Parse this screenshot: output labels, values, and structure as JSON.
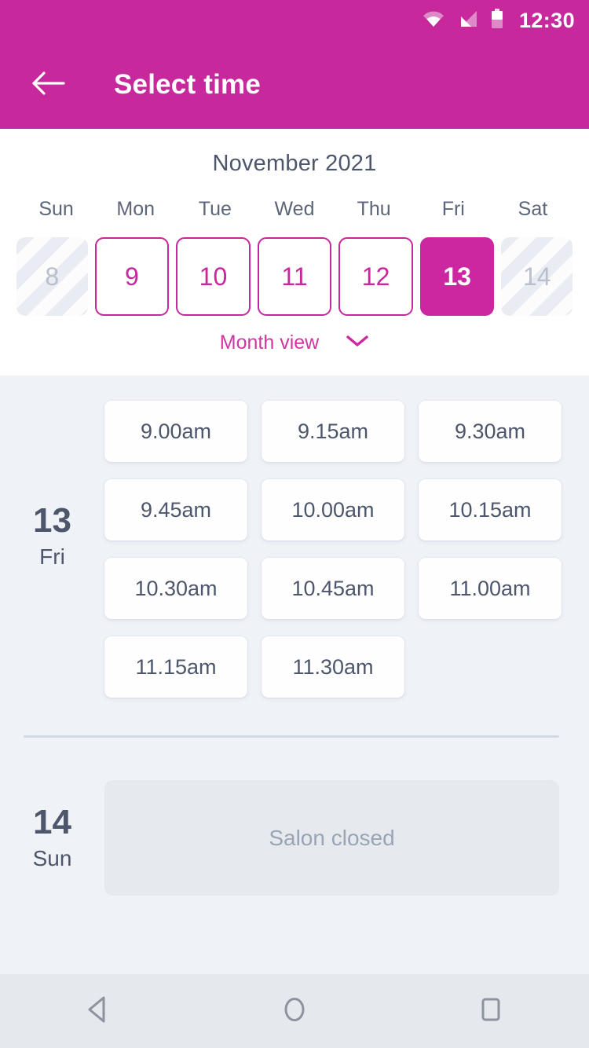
{
  "status_bar": {
    "clock": "12:30",
    "icons": [
      "wifi-icon",
      "signal-icon",
      "battery-icon"
    ]
  },
  "app_bar": {
    "back_icon": "back-arrow-icon",
    "title": "Select time"
  },
  "calendar": {
    "month_label": "November 2021",
    "weekdays": [
      "Sun",
      "Mon",
      "Tue",
      "Wed",
      "Thu",
      "Fri",
      "Sat"
    ],
    "days": [
      {
        "number": "8",
        "state": "disabled"
      },
      {
        "number": "9",
        "state": "available"
      },
      {
        "number": "10",
        "state": "available"
      },
      {
        "number": "11",
        "state": "available"
      },
      {
        "number": "12",
        "state": "available"
      },
      {
        "number": "13",
        "state": "selected"
      },
      {
        "number": "14",
        "state": "disabled"
      }
    ],
    "month_view_label": "Month view",
    "month_view_icon": "chevron-down-icon"
  },
  "schedule": [
    {
      "day_number": "13",
      "day_of_week": "Fri",
      "slots": [
        "9.00am",
        "9.15am",
        "9.30am",
        "9.45am",
        "10.00am",
        "10.15am",
        "10.30am",
        "10.45am",
        "11.00am",
        "11.15am",
        "11.30am"
      ]
    },
    {
      "day_number": "14",
      "day_of_week": "Sun",
      "closed_message": "Salon closed"
    }
  ],
  "nav_bar": {
    "back_label": "back-triangle-icon",
    "home_label": "home-circle-icon",
    "recents_label": "recents-square-icon"
  },
  "colors": {
    "brand_magenta": "#c7289b",
    "selected_day": "#cc27a0",
    "slate_text": "#4d566b",
    "body_background": "#eff2f7",
    "closed_card": "#e6eaef"
  }
}
